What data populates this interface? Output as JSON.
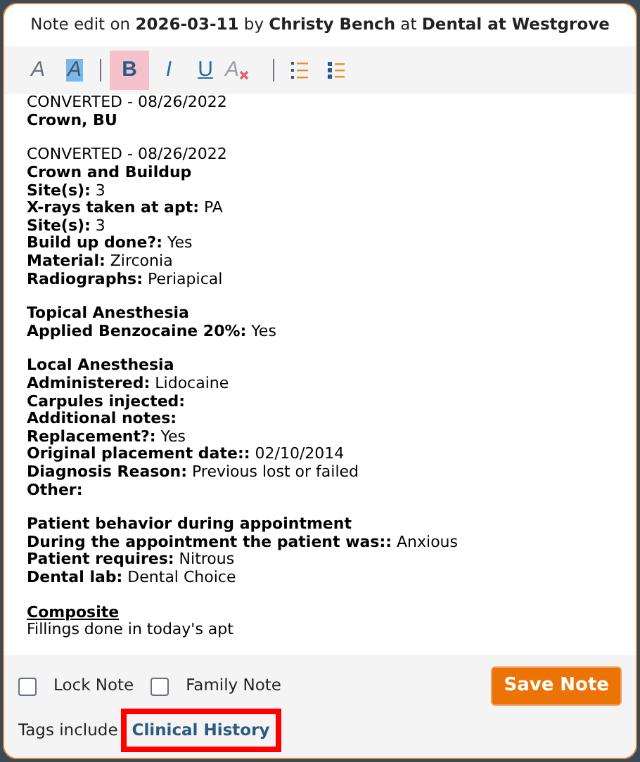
{
  "header": {
    "prefix": "Note edit on",
    "date": "2026-03-11",
    "by": "by",
    "author": "Christy Bench",
    "at": "at",
    "location": "Dental at Westgrove"
  },
  "toolbar": [
    {
      "kind": "font-color",
      "label": "A",
      "selected": false
    },
    {
      "kind": "highlight",
      "label": "A",
      "selected": false
    },
    {
      "kind": "separator"
    },
    {
      "kind": "bold",
      "label": "B",
      "selected": true
    },
    {
      "kind": "italic",
      "label": "I",
      "selected": false
    },
    {
      "kind": "underline",
      "label": "U",
      "selected": false
    },
    {
      "kind": "clear",
      "label": "A",
      "selected": false
    },
    {
      "kind": "separator"
    },
    {
      "kind": "ordered-list",
      "selected": false
    },
    {
      "kind": "bullet-list",
      "selected": false
    }
  ],
  "blocks": [
    [
      {
        "kind": "plain",
        "text": "CONVERTED - 08/26/2022"
      },
      {
        "kind": "heading",
        "text": "Crown, BU"
      }
    ],
    [
      {
        "kind": "plain",
        "text": "CONVERTED - 08/26/2022"
      },
      {
        "kind": "heading",
        "text": "Crown and Buildup"
      },
      {
        "kind": "plain",
        "text": "**Site(s):** 3"
      },
      {
        "kind": "plain",
        "text": "**X-rays taken at apt:** PA"
      },
      {
        "kind": "plain",
        "text": "**Site(s):** 3"
      },
      {
        "kind": "plain",
        "text": "**Build up done?:** Yes"
      },
      {
        "kind": "plain",
        "text": "**Material:** Zirconia"
      },
      {
        "kind": "plain",
        "text": "**Radiographs:** Periapical"
      }
    ],
    [
      {
        "kind": "heading",
        "text": "Topical Anesthesia"
      },
      {
        "kind": "plain",
        "text": "**Applied Benzocaine 20%:** Yes"
      }
    ],
    [
      {
        "kind": "heading",
        "text": "Local Anesthesia"
      },
      {
        "kind": "plain",
        "text": "**Administered:** Lidocaine"
      },
      {
        "kind": "heading",
        "text": "Carpules injected:"
      },
      {
        "kind": "heading",
        "text": "Additional notes:"
      },
      {
        "kind": "plain",
        "text": "**Replacement?:** Yes"
      },
      {
        "kind": "plain",
        "text": "**Original placement date::** 02/10/2014"
      },
      {
        "kind": "plain",
        "text": "**Diagnosis Reason:** Previous lost or failed"
      },
      {
        "kind": "heading",
        "text": "Other:"
      }
    ],
    [
      {
        "kind": "heading",
        "text": "Patient behavior during appointment"
      },
      {
        "kind": "plain",
        "text": "**During the appointment the patient was::** Anxious"
      },
      {
        "kind": "plain",
        "text": "**Patient requires:** Nitrous"
      },
      {
        "kind": "plain",
        "text": "**Dental lab:** Dental Choice"
      }
    ],
    [
      {
        "kind": "underlined",
        "text": "Composite"
      },
      {
        "kind": "plain",
        "text": "Fillings done in today's apt"
      }
    ]
  ],
  "options": [
    {
      "label": "Lock Note",
      "checked": false
    },
    {
      "label": "Family Note",
      "checked": false
    }
  ],
  "save_button": "Save Note",
  "tags": {
    "label": "Tags include",
    "tag": "Clinical History",
    "highlighted": true
  }
}
